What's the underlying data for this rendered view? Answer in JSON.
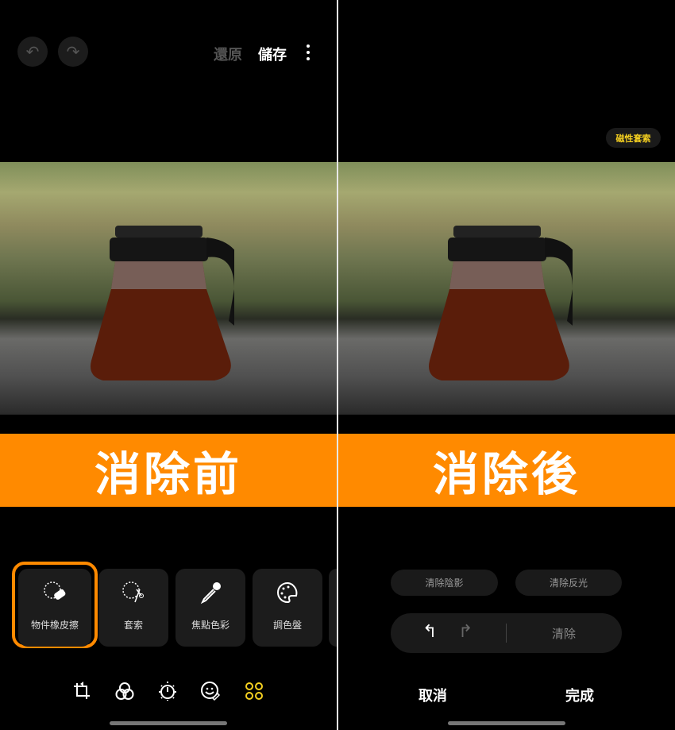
{
  "left": {
    "toolbar": {
      "undo_icon": "undo-icon",
      "redo_icon": "redo-icon",
      "revert_label": "還原",
      "save_label": "儲存",
      "more_icon": "more-vertical-icon"
    },
    "banner": "消除前",
    "tools": [
      {
        "label": "物件橡皮擦",
        "icon": "object-eraser-icon",
        "selected": true
      },
      {
        "label": "套索",
        "icon": "lasso-scissors-icon"
      },
      {
        "label": "焦點色彩",
        "icon": "eyedropper-icon"
      },
      {
        "label": "調色盤",
        "icon": "palette-icon"
      }
    ],
    "nav_icons": [
      "crop-rotate-icon",
      "filters-icon",
      "brightness-icon",
      "sticker-icon",
      "more-tools-icon"
    ],
    "accent": "#ff8a00",
    "active_nav_color": "#f5d020"
  },
  "right": {
    "magnetic_lasso_label": "磁性套索",
    "banner": "消除後",
    "remove_shadow_label": "清除陰影",
    "remove_reflection_label": "清除反光",
    "erase_label": "清除",
    "cancel_label": "取消",
    "done_label": "完成"
  }
}
